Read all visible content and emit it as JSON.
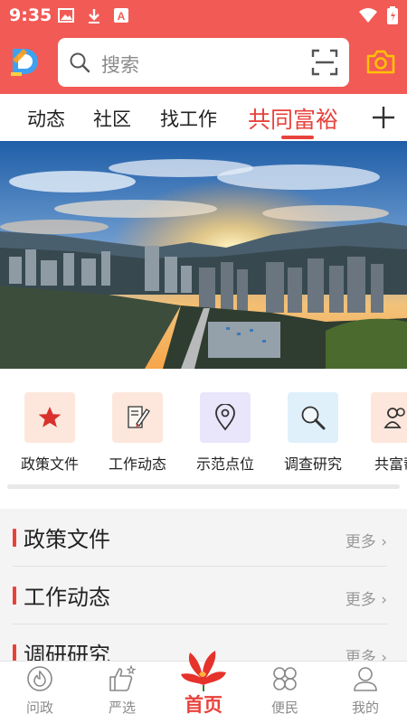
{
  "status": {
    "time": "9:35"
  },
  "search": {
    "placeholder": "搜索"
  },
  "tabs": [
    {
      "label": "动态"
    },
    {
      "label": "社区"
    },
    {
      "label": "找工作"
    },
    {
      "label": "共同富裕",
      "active": true
    }
  ],
  "quick": [
    {
      "label": "政策文件",
      "icon": "star-icon"
    },
    {
      "label": "工作动态",
      "icon": "document-pen-icon"
    },
    {
      "label": "示范点位",
      "icon": "location-pin-icon"
    },
    {
      "label": "调查研究",
      "icon": "magnifier-icon"
    },
    {
      "label": "共富帮",
      "icon": "people-icon"
    }
  ],
  "list": [
    {
      "title": "政策文件",
      "more": "更多"
    },
    {
      "title": "工作动态",
      "more": "更多"
    },
    {
      "title": "调研研究",
      "more": "更多"
    }
  ],
  "nav": [
    {
      "label": "问政",
      "icon": "fire-icon"
    },
    {
      "label": "严选",
      "icon": "thumbs-up-icon"
    },
    {
      "label": "首页",
      "icon": "flower-icon",
      "active": true
    },
    {
      "label": "便民",
      "icon": "grid-icon"
    },
    {
      "label": "我的",
      "icon": "user-icon"
    }
  ],
  "colors": {
    "brand": "#f25a55",
    "accent": "#e8423c",
    "camera": "#ffc107"
  }
}
